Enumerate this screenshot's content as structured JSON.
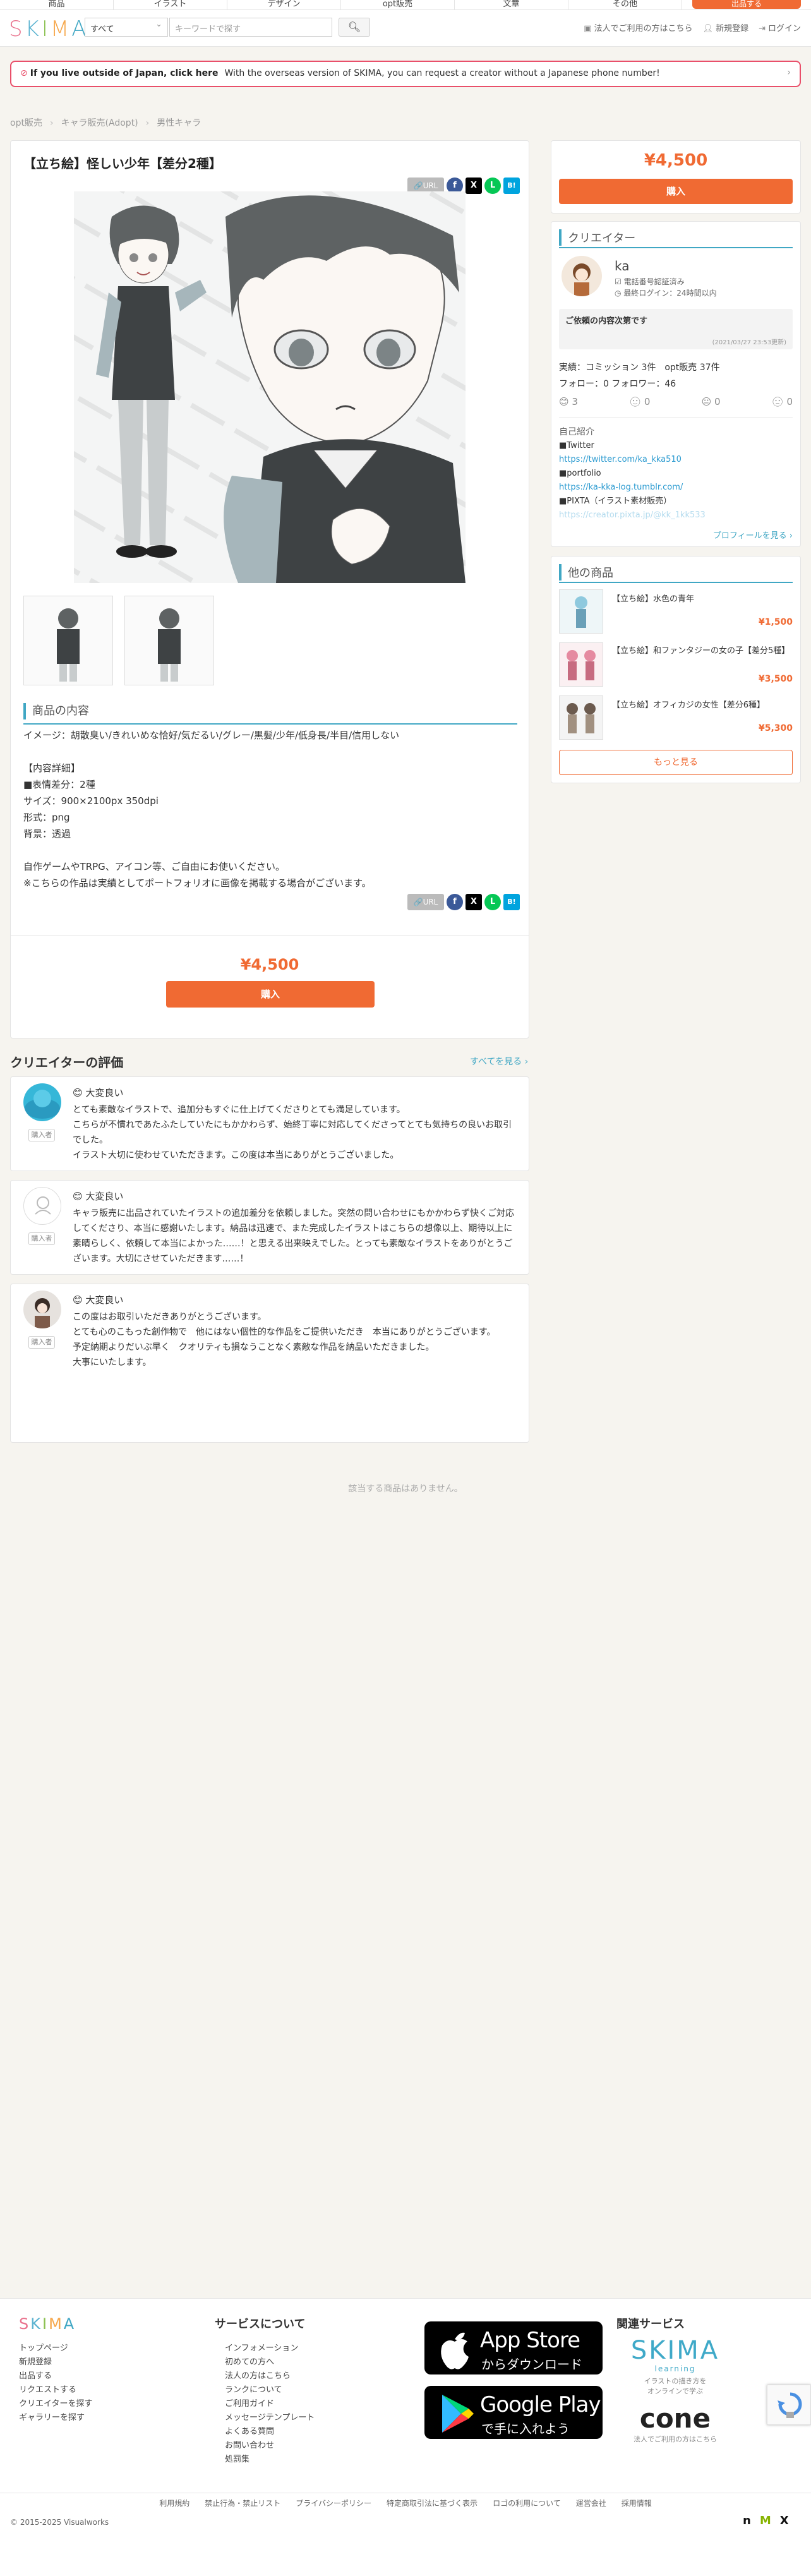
{
  "topnav": {
    "items": [
      "商品",
      "イラスト",
      "デザイン",
      "opt販売",
      "文章",
      "その他"
    ],
    "cta": "出品する"
  },
  "header": {
    "logo_letters": [
      "S",
      "K",
      "I",
      "M",
      "A"
    ],
    "logo_colors": [
      "#e9718c",
      "#5bb3d0",
      "#8cc152",
      "#f6a74b",
      "#40a7c4"
    ],
    "category": "すべて",
    "keyword_placeholder": "キーワードで探す",
    "search_icon": "search-icon",
    "links": [
      {
        "icon": "lock-icon",
        "label": "法人でご利用の方はこちら"
      },
      {
        "icon": "user-plus-icon",
        "label": "新規登録"
      },
      {
        "icon": "login-icon",
        "label": "ログイン"
      }
    ]
  },
  "banner": {
    "icon": "!",
    "title": "If you live outside of Japan, click here",
    "text": "With the overseas version of SKIMA, you can request a creator without a Japanese phone number!",
    "arrow": "›"
  },
  "breadcrumb": [
    "opt販売",
    "キャラ販売(Adopt)",
    "男性キャラ"
  ],
  "product": {
    "title": "【立ち絵】怪しい少年【差分2種】",
    "share": {
      "url_label": "URL",
      "fb": "f",
      "x": "X",
      "line": "L",
      "hatena": "B!"
    },
    "section_title": "商品の内容",
    "description": "イメージ：胡散臭い/きれいめな恰好/気だるい/グレー/黒髪/少年/低身長/半目/信用しない\n\n【内容詳細】\n■表情差分：2種\nサイズ：900×2100px 350dpi\n形式：png\n背景：透過\n\n自作ゲームやTRPG、アイコン等、ご自由にお使いください。\n※こちらの作品は実績としてポートフォリオに画像を掲載する場合がございます。",
    "price": "¥4,500",
    "buy_label": "購入"
  },
  "sidebar": {
    "price": "¥4,500",
    "buy_label": "購入",
    "creator_title": "クリエイター",
    "creator_name": "ka",
    "verified": "電話番号認証済み",
    "last_login": "最終ログイン：24時間以内",
    "status_msg": "ご依頼の内容次第です",
    "status_date": "(2021/03/27 23:53更新)",
    "stats": "実績：コミッション 3件　opt販売 37件",
    "follow": "フォロー：0 フォロワー：46",
    "ratings": [
      "3",
      "0",
      "0",
      "0"
    ],
    "intro_title": "自己紹介",
    "intro_lines": [
      "■Twitter",
      "https://twitter.com/ka_kka510",
      "■portfolio",
      "https://ka-kka-log.tumblr.com/",
      "■PIXTA（イラスト素材販売）",
      "https://creator.pixta.jp/@kk_1kk533"
    ],
    "profile_link": "プロフィールを見る ›",
    "others_title": "他の商品",
    "others": [
      {
        "title": "【立ち絵】水色の青年",
        "price": "¥1,500"
      },
      {
        "title": "【立ち絵】和ファンタジーの女の子【差分5種】",
        "price": "¥3,500"
      },
      {
        "title": "【立ち絵】オフィカジの女性【差分6種】",
        "price": "¥5,300"
      }
    ],
    "more_label": "もっと見る"
  },
  "reviews": {
    "title": "クリエイターの評価",
    "see_all": "すべてを見る ›",
    "buyer_label": "購入者",
    "items": [
      {
        "rating": "大変良い",
        "text": "とても素敵なイラストで、追加分もすぐに仕上げてくださりとても満足しています。\nこちらが不慣れであたふたしていたにもかかわらず、始終丁寧に対応してくださってとても気持ちの良いお取引でした。\nイラスト大切に使わせていただきます。この度は本当にありがとうございました。"
      },
      {
        "rating": "大変良い",
        "text": "キャラ販売に出品されていたイラストの追加差分を依頼しました。突然の問い合わせにもかかわらず快くご対応してくださり、本当に感謝いたします。納品は迅速で、また完成したイラストはこちらの想像以上、期待以上に素晴らしく、依頼して本当によかった……！と思える出来映えでした。とっても素敵なイラストをありがとうございます。大切にさせていただきます……！"
      },
      {
        "rating": "大変良い",
        "text": "この度はお取引いただきありがとうございます。\nとても心のこもった創作物で　他にはない個性的な作品をご提供いただき　本当にありがとうございます。\n予定納期よりだいぶ早く　クオリティも損なうことなく素敵な作品を納品いただきました。\n大事にいたします。"
      }
    ]
  },
  "related_empty": "該当する商品はありません。",
  "footer": {
    "logo_letters": [
      "S",
      "K",
      "I",
      "M",
      "A"
    ],
    "left_links": [
      "トップページ",
      "新規登録",
      "出品する",
      "リクエストする",
      "クリエイターを探す",
      "ギャラリーを探す"
    ],
    "service_title": "サービスについて",
    "service_links": [
      "インフォメーション",
      "初めての方へ",
      "法人の方はこちら",
      "ランクについて",
      "ご利用ガイド",
      "メッセージテンプレート",
      "よくある質問",
      "お問い合わせ",
      "処罰集"
    ],
    "appstore_big": "App Store",
    "appstore_small": "からダウンロード",
    "google_big": "Google Play",
    "google_small": "で手に入れよう",
    "related_title": "関連サービス",
    "skima_learning_name": "SKIMA",
    "skima_learning_sub": "learning",
    "skima_learning_desc1": "イラストの描き方を",
    "skima_learning_desc2": "オンラインで学ぶ",
    "cone_name": "cone",
    "cone_desc": "法人でご利用の方はこちら",
    "bottom_links": [
      "利用規約",
      "禁止行為・禁止リスト",
      "プライバシーポリシー",
      "特定商取引法に基づく表示",
      "ロゴの利用について",
      "運営会社",
      "採用情報"
    ],
    "copyright": "© 2015-2025 Visualworks"
  }
}
